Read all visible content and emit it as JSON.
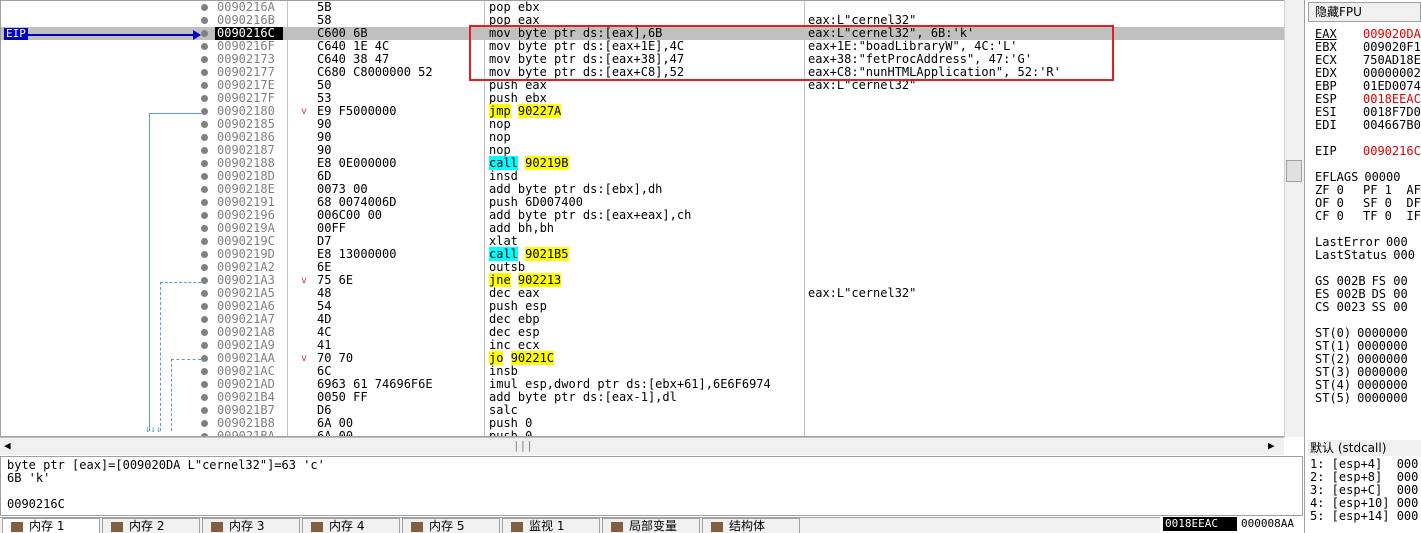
{
  "eip_label": "EIP",
  "rows": [
    {
      "addr": "0090216A",
      "bytes": "5B",
      "instr": [
        {
          "t": "pop ebx"
        }
      ],
      "cmt": "",
      "selected": false,
      "arrow": ""
    },
    {
      "addr": "0090216B",
      "bytes": "58",
      "instr": [
        {
          "t": "pop eax"
        }
      ],
      "cmt": "eax:L\"cernel32\"",
      "selected": false,
      "arrow": ""
    },
    {
      "addr": "0090216C",
      "bytes": "C600 6B",
      "instr": [
        {
          "t": "mov byte ptr ds:[eax],6B"
        }
      ],
      "cmt": "eax:L\"cernel32\", 6B:'k'",
      "selected": true,
      "arrow": ""
    },
    {
      "addr": "0090216F",
      "bytes": "C640 1E 4C",
      "instr": [
        {
          "t": "mov byte ptr ds:[eax+1E],4C"
        }
      ],
      "cmt": "eax+1E:\"boadLibraryW\", 4C:'L'",
      "selected": false,
      "arrow": ""
    },
    {
      "addr": "00902173",
      "bytes": "C640 38 47",
      "instr": [
        {
          "t": "mov byte ptr ds:[eax+38],47"
        }
      ],
      "cmt": "eax+38:\"fetProcAddress\", 47:'G'",
      "selected": false,
      "arrow": ""
    },
    {
      "addr": "00902177",
      "bytes": "C680 C8000000 52",
      "instr": [
        {
          "t": "mov byte ptr ds:[eax+C8],52"
        }
      ],
      "cmt": "eax+C8:\"nunHTMLApplication\", 52:'R'",
      "selected": false,
      "arrow": ""
    },
    {
      "addr": "0090217E",
      "bytes": "50",
      "instr": [
        {
          "t": "push eax"
        }
      ],
      "cmt": "eax:L\"cernel32\"",
      "selected": false,
      "arrow": ""
    },
    {
      "addr": "0090217F",
      "bytes": "53",
      "instr": [
        {
          "t": "push ebx"
        }
      ],
      "cmt": "",
      "selected": false,
      "arrow": ""
    },
    {
      "addr": "00902180",
      "bytes": "E9 F5000000",
      "instr": [
        {
          "t": "jmp",
          "hl": "yellow"
        },
        {
          "t": " "
        },
        {
          "t": "90227A",
          "hl": "yellow"
        }
      ],
      "cmt": "",
      "selected": false,
      "arrow": "v"
    },
    {
      "addr": "00902185",
      "bytes": "90",
      "instr": [
        {
          "t": "nop"
        }
      ],
      "cmt": "",
      "selected": false,
      "arrow": ""
    },
    {
      "addr": "00902186",
      "bytes": "90",
      "instr": [
        {
          "t": "nop"
        }
      ],
      "cmt": "",
      "selected": false,
      "arrow": ""
    },
    {
      "addr": "00902187",
      "bytes": "90",
      "instr": [
        {
          "t": "nop"
        }
      ],
      "cmt": "",
      "selected": false,
      "arrow": ""
    },
    {
      "addr": "00902188",
      "bytes": "E8 0E000000",
      "instr": [
        {
          "t": "call",
          "hl": "cyan"
        },
        {
          "t": " "
        },
        {
          "t": "90219B",
          "hl": "yellow"
        }
      ],
      "cmt": "",
      "selected": false,
      "arrow": ""
    },
    {
      "addr": "0090218D",
      "bytes": "6D",
      "instr": [
        {
          "t": "insd"
        }
      ],
      "cmt": "",
      "selected": false,
      "arrow": ""
    },
    {
      "addr": "0090218E",
      "bytes": "0073 00",
      "instr": [
        {
          "t": "add byte ptr ds:[ebx],dh"
        }
      ],
      "cmt": "",
      "selected": false,
      "arrow": ""
    },
    {
      "addr": "00902191",
      "bytes": "68 0074006D",
      "instr": [
        {
          "t": "push 6D007400"
        }
      ],
      "cmt": "",
      "selected": false,
      "arrow": ""
    },
    {
      "addr": "00902196",
      "bytes": "006C00 00",
      "instr": [
        {
          "t": "add byte ptr ds:[eax+eax],ch"
        }
      ],
      "cmt": "",
      "selected": false,
      "arrow": ""
    },
    {
      "addr": "0090219A",
      "bytes": "00FF",
      "instr": [
        {
          "t": "add bh,bh"
        }
      ],
      "cmt": "",
      "selected": false,
      "arrow": ""
    },
    {
      "addr": "0090219C",
      "bytes": "D7",
      "instr": [
        {
          "t": "xlat"
        }
      ],
      "cmt": "",
      "selected": false,
      "arrow": ""
    },
    {
      "addr": "0090219D",
      "bytes": "E8 13000000",
      "instr": [
        {
          "t": "call",
          "hl": "cyan"
        },
        {
          "t": " "
        },
        {
          "t": "9021B5",
          "hl": "yellow"
        }
      ],
      "cmt": "",
      "selected": false,
      "arrow": ""
    },
    {
      "addr": "009021A2",
      "bytes": "6E",
      "instr": [
        {
          "t": "outsb"
        }
      ],
      "cmt": "",
      "selected": false,
      "arrow": ""
    },
    {
      "addr": "009021A3",
      "bytes": "75 6E",
      "instr": [
        {
          "t": "jne",
          "hl": "yellow"
        },
        {
          "t": " "
        },
        {
          "t": "902213",
          "hl": "yellow"
        }
      ],
      "cmt": "",
      "selected": false,
      "arrow": "v"
    },
    {
      "addr": "009021A5",
      "bytes": "48",
      "instr": [
        {
          "t": "dec eax"
        }
      ],
      "cmt": "eax:L\"cernel32\"",
      "selected": false,
      "arrow": ""
    },
    {
      "addr": "009021A6",
      "bytes": "54",
      "instr": [
        {
          "t": "push esp"
        }
      ],
      "cmt": "",
      "selected": false,
      "arrow": ""
    },
    {
      "addr": "009021A7",
      "bytes": "4D",
      "instr": [
        {
          "t": "dec ebp"
        }
      ],
      "cmt": "",
      "selected": false,
      "arrow": ""
    },
    {
      "addr": "009021A8",
      "bytes": "4C",
      "instr": [
        {
          "t": "dec esp"
        }
      ],
      "cmt": "",
      "selected": false,
      "arrow": ""
    },
    {
      "addr": "009021A9",
      "bytes": "41",
      "instr": [
        {
          "t": "inc ecx"
        }
      ],
      "cmt": "",
      "selected": false,
      "arrow": ""
    },
    {
      "addr": "009021AA",
      "bytes": "70 70",
      "instr": [
        {
          "t": "jo",
          "hl": "yellow"
        },
        {
          "t": " "
        },
        {
          "t": "90221C",
          "hl": "yellow"
        }
      ],
      "cmt": "",
      "selected": false,
      "arrow": "v"
    },
    {
      "addr": "009021AC",
      "bytes": "6C",
      "instr": [
        {
          "t": "insb"
        }
      ],
      "cmt": "",
      "selected": false,
      "arrow": ""
    },
    {
      "addr": "009021AD",
      "bytes": "6963 61 74696F6E",
      "instr": [
        {
          "t": "imul esp,dword ptr ds:[ebx+61],6E6F6974"
        }
      ],
      "cmt": "",
      "selected": false,
      "arrow": ""
    },
    {
      "addr": "009021B4",
      "bytes": "0050 FF",
      "instr": [
        {
          "t": "add byte ptr ds:[eax-1],dl"
        }
      ],
      "cmt": "",
      "selected": false,
      "arrow": ""
    },
    {
      "addr": "009021B7",
      "bytes": "D6",
      "instr": [
        {
          "t": "salc"
        }
      ],
      "cmt": "",
      "selected": false,
      "arrow": ""
    },
    {
      "addr": "009021B8",
      "bytes": "6A 00",
      "instr": [
        {
          "t": "push 0"
        }
      ],
      "cmt": "",
      "selected": false,
      "arrow": ""
    },
    {
      "addr": "009021BA",
      "bytes": "6A 00",
      "instr": [
        {
          "t": "push 0"
        }
      ],
      "cmt": "",
      "selected": false,
      "arrow": ""
    }
  ],
  "info": {
    "line1": "byte ptr [eax]=[009020DA L\"cernel32\"]=63 'c'",
    "line2": "6B 'k'",
    "line3": "",
    "line4": "0090216C"
  },
  "registers_header": "隐藏FPU",
  "registers": [
    {
      "name": "EAX",
      "value": "009020DA",
      "red": true,
      "underline": true
    },
    {
      "name": "EBX",
      "value": "009020F1",
      "red": false
    },
    {
      "name": "ECX",
      "value": "750AD18E",
      "red": false
    },
    {
      "name": "EDX",
      "value": "00000002",
      "red": false
    },
    {
      "name": "EBP",
      "value": "01ED0074",
      "red": false
    },
    {
      "name": "ESP",
      "value": "0018EEAC",
      "red": true
    },
    {
      "name": "ESI",
      "value": "0018F7D0",
      "red": false
    },
    {
      "name": "EDI",
      "value": "004667B0",
      "red": false
    },
    {
      "name": "",
      "value": "",
      "red": false
    },
    {
      "name": "EIP",
      "value": "0090216C",
      "red": true
    },
    {
      "name": "",
      "value": "",
      "red": false
    },
    {
      "name": "EFLAGS",
      "value": "00000",
      "red": false
    },
    {
      "name": "ZF 0",
      "value": "PF 1  AF",
      "red": false
    },
    {
      "name": "OF 0",
      "value": "SF 0  DF",
      "red": false
    },
    {
      "name": "CF 0",
      "value": "TF 0  IF",
      "red": false
    },
    {
      "name": "",
      "value": "",
      "red": false
    },
    {
      "name": "LastError",
      "value": "000",
      "red": false
    },
    {
      "name": "LastStatus",
      "value": "000",
      "red": false
    },
    {
      "name": "",
      "value": "",
      "red": false
    },
    {
      "name": "GS 002B",
      "value": "FS 00",
      "red": false
    },
    {
      "name": "ES 002B",
      "value": "DS 00",
      "red": false
    },
    {
      "name": "CS 0023",
      "value": "SS 00",
      "red": false
    },
    {
      "name": "",
      "value": "",
      "red": false
    },
    {
      "name": "ST(0)",
      "value": "0000000",
      "red": false
    },
    {
      "name": "ST(1)",
      "value": "0000000",
      "red": false
    },
    {
      "name": "ST(2)",
      "value": "0000000",
      "red": false
    },
    {
      "name": "ST(3)",
      "value": "0000000",
      "red": false
    },
    {
      "name": "ST(4)",
      "value": "0000000",
      "red": false
    },
    {
      "name": "ST(5)",
      "value": "0000000",
      "red": false
    }
  ],
  "stack_header": "默认 (stdcall)",
  "stack": [
    "1: [esp+4]  000",
    "2: [esp+8]  000",
    "3: [esp+C]  000",
    "4: [esp+10] 000",
    "5: [esp+14] 000"
  ],
  "tabs": [
    {
      "label": "内存 1",
      "active": true
    },
    {
      "label": "内存 2",
      "active": false
    },
    {
      "label": "内存 3",
      "active": false
    },
    {
      "label": "内存 4",
      "active": false
    },
    {
      "label": "内存 5",
      "active": false
    },
    {
      "label": "监视 1",
      "active": false
    },
    {
      "label": "局部变量",
      "active": false
    },
    {
      "label": "结构体",
      "active": false
    }
  ],
  "dump": {
    "address": "0018EEAC",
    "value": "000008AA"
  },
  "colors": {
    "selection": "#c0c0c0",
    "call": "#00ffff",
    "jump": "#ffff00",
    "eip_arrow": "#0000c0",
    "highlight_box": "#e02020",
    "register_changed": "#e00000"
  }
}
